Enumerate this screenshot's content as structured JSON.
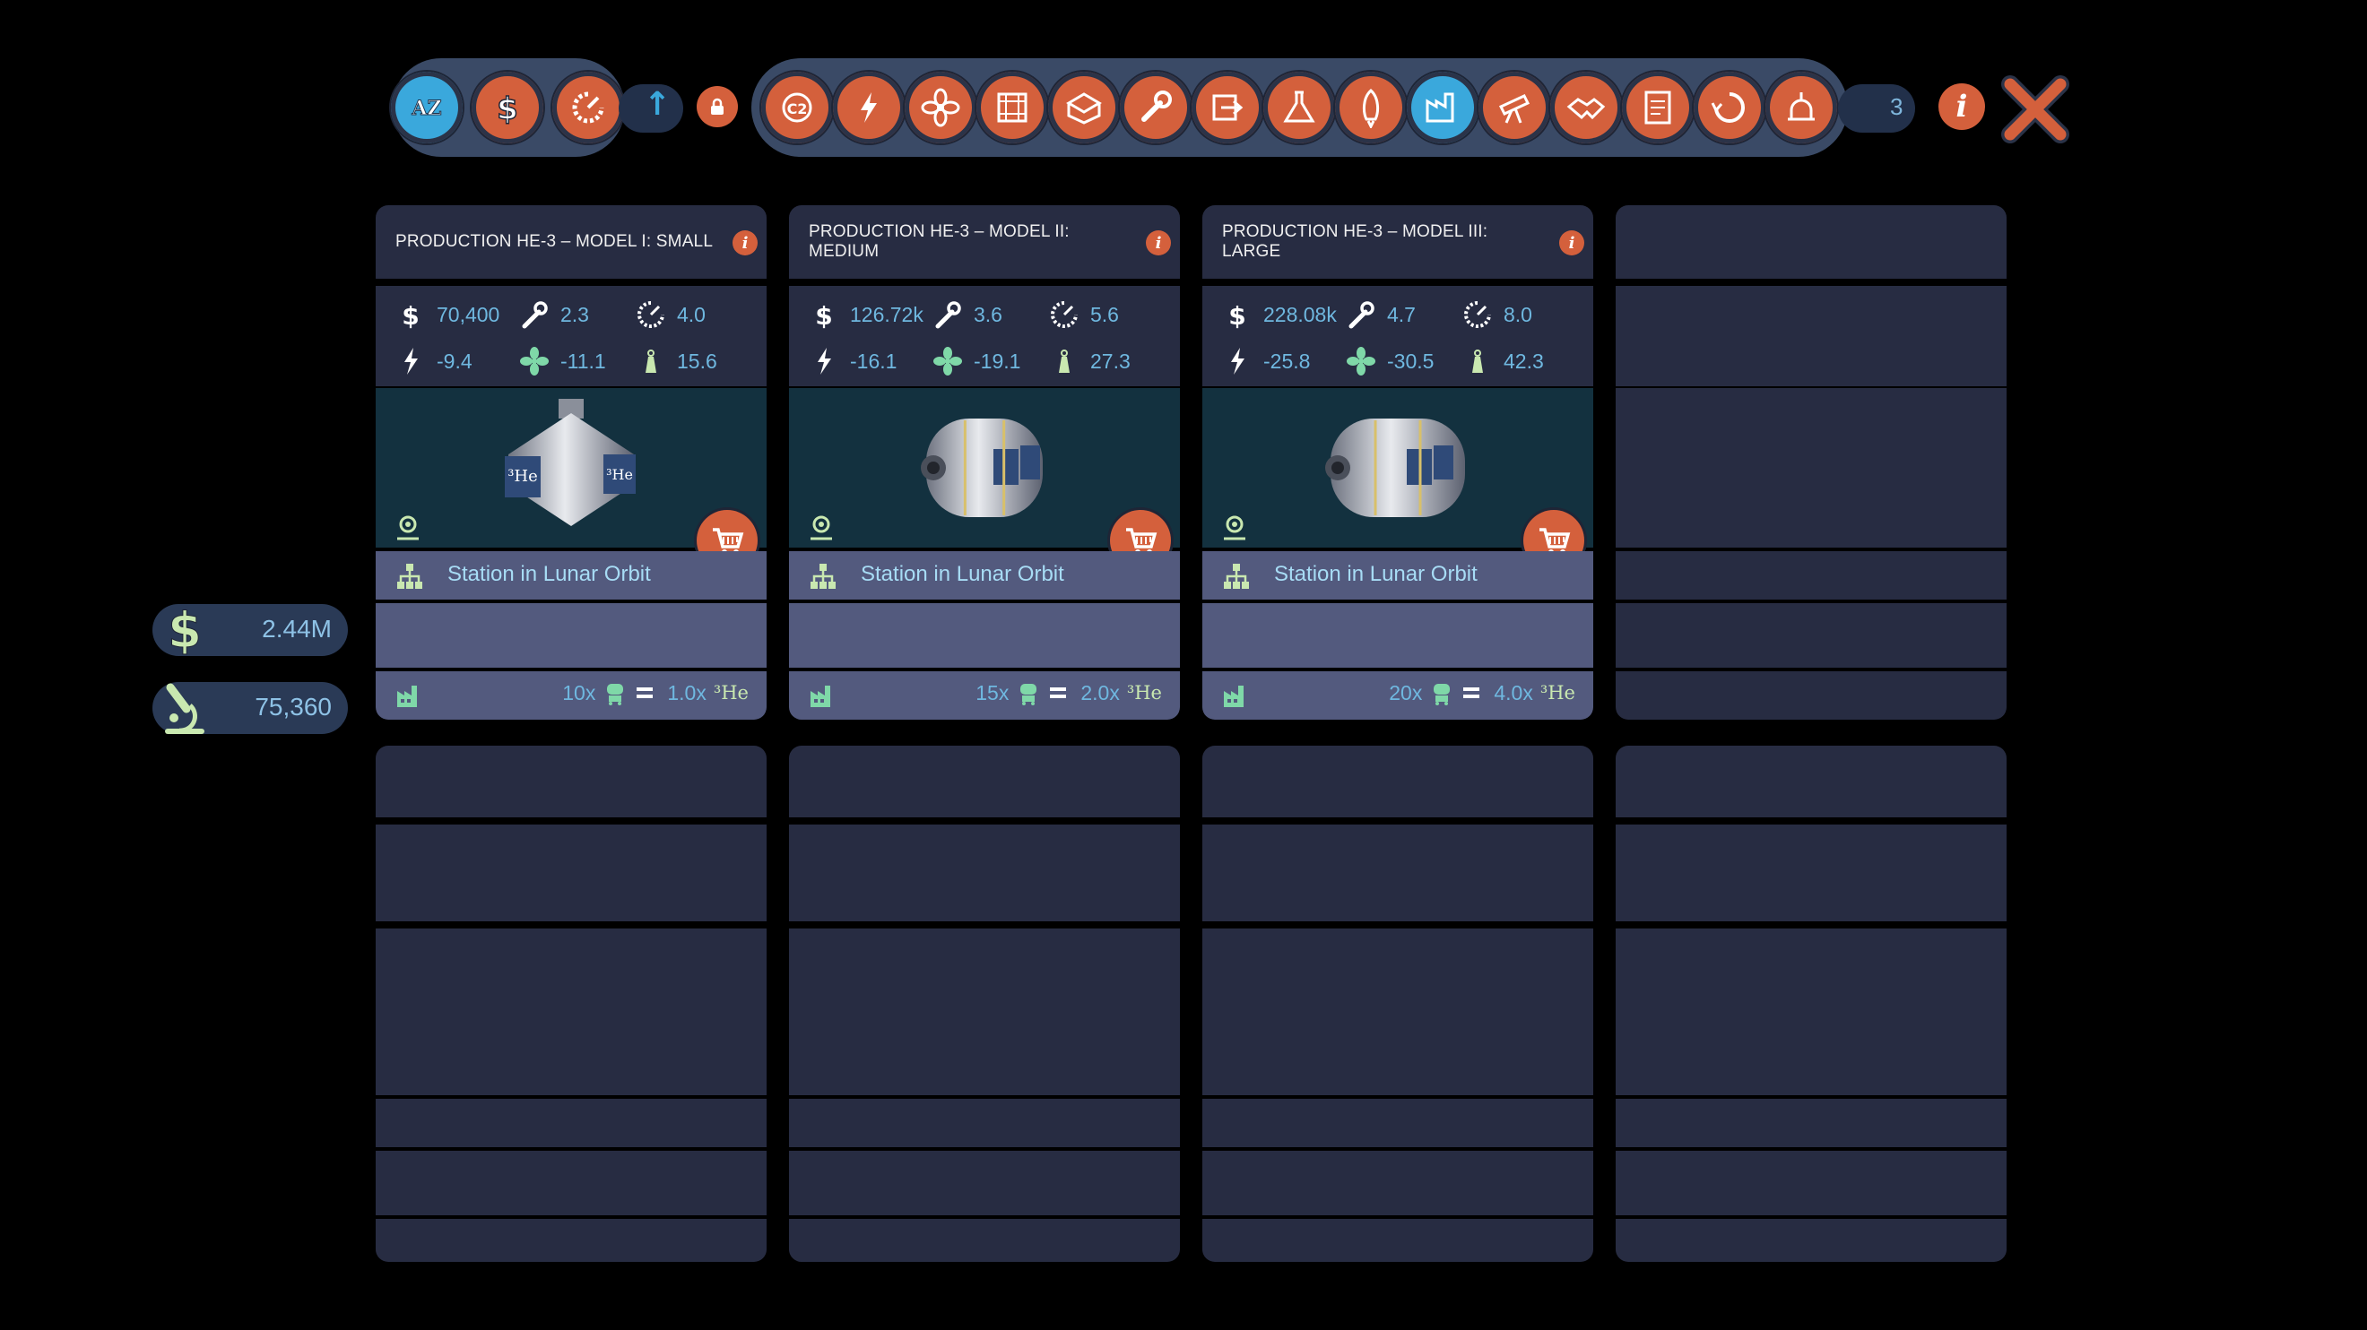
{
  "toolbar": {
    "sort_buttons": [
      {
        "name": "sort-az",
        "label": "AZ",
        "active": true
      },
      {
        "name": "sort-cost",
        "icon": "dollar-icon",
        "active": false
      },
      {
        "name": "sort-research",
        "icon": "research-dial-icon",
        "active": false
      }
    ],
    "category_buttons": [
      {
        "name": "crew-icon",
        "active": false
      },
      {
        "name": "power-icon",
        "active": false
      },
      {
        "name": "cooling-fan-icon",
        "active": false
      },
      {
        "name": "structure-icon",
        "active": false
      },
      {
        "name": "storage-icon",
        "active": false
      },
      {
        "name": "maintenance-icon",
        "active": false
      },
      {
        "name": "docking-icon",
        "active": false
      },
      {
        "name": "lab-icon",
        "active": false
      },
      {
        "name": "rocket-icon",
        "active": false
      },
      {
        "name": "factory-icon",
        "active": true
      },
      {
        "name": "telescope-icon",
        "active": false
      },
      {
        "name": "handshake-icon",
        "active": false
      },
      {
        "name": "document-icon",
        "active": false
      },
      {
        "name": "recycle-icon",
        "active": false
      },
      {
        "name": "observatory-icon",
        "active": false
      }
    ],
    "result_count": "3",
    "colors": {
      "accent": "#d4603c",
      "active": "#3aa8dc",
      "bar": "#3a4a66"
    }
  },
  "resources": {
    "money": "2.44M",
    "research": "75,360"
  },
  "cards": [
    {
      "title": "PRODUCTION HE-3 – MODEL I: SMALL",
      "stats": {
        "cost": "70,400",
        "maintenance": "2.3",
        "research": "4.0",
        "power": "-9.4",
        "cooling": "-11.1",
        "mass": "15.6"
      },
      "location": "Station in Lunar Orbit",
      "production": {
        "workers": "10x",
        "output": "1.0x",
        "resource": "³He"
      }
    },
    {
      "title": "PRODUCTION HE-3 – MODEL II: MEDIUM",
      "stats": {
        "cost": "126.72k",
        "maintenance": "3.6",
        "research": "5.6",
        "power": "-16.1",
        "cooling": "-19.1",
        "mass": "27.3"
      },
      "location": "Station in Lunar Orbit",
      "production": {
        "workers": "15x",
        "output": "2.0x",
        "resource": "³He"
      }
    },
    {
      "title": "PRODUCTION HE-3 – MODEL III: LARGE",
      "stats": {
        "cost": "228.08k",
        "maintenance": "4.7",
        "research": "8.0",
        "power": "-25.8",
        "cooling": "-30.5",
        "mass": "42.3"
      },
      "location": "Station in Lunar Orbit",
      "production": {
        "workers": "20x",
        "output": "4.0x",
        "resource": "³He"
      }
    }
  ]
}
